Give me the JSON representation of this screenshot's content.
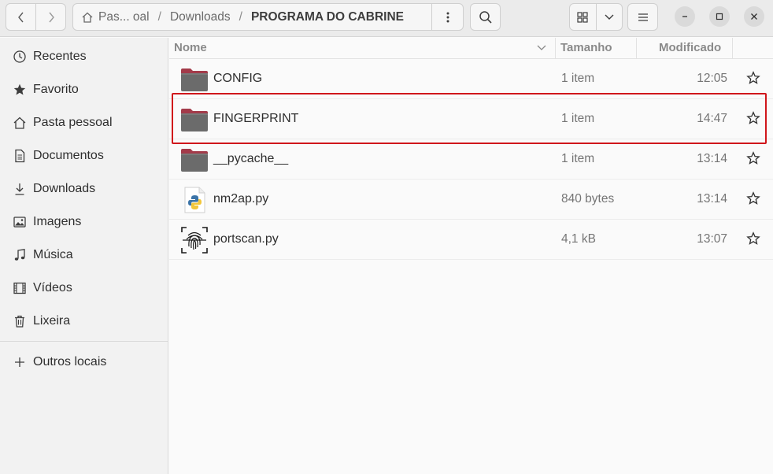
{
  "header": {
    "path": [
      "Pas... oal",
      "Downloads",
      "PROGRAMA DO CABRINE"
    ],
    "back_icon": "chevron-left-icon",
    "forward_icon": "chevron-right-icon",
    "home_icon": "home-icon"
  },
  "sidebar": {
    "items": [
      {
        "label": "Recentes",
        "icon": "clock-icon"
      },
      {
        "label": "Favorito",
        "icon": "star-icon"
      },
      {
        "label": "Pasta pessoal",
        "icon": "home-icon"
      },
      {
        "label": "Documentos",
        "icon": "document-icon"
      },
      {
        "label": "Downloads",
        "icon": "download-icon"
      },
      {
        "label": "Imagens",
        "icon": "image-icon"
      },
      {
        "label": "Música",
        "icon": "music-icon"
      },
      {
        "label": "Vídeos",
        "icon": "film-icon"
      },
      {
        "label": "Lixeira",
        "icon": "trash-icon"
      }
    ],
    "other": {
      "label": "Outros locais",
      "icon": "plus-icon"
    }
  },
  "columns": {
    "name": "Nome",
    "size": "Tamanho",
    "modified": "Modificado"
  },
  "files": [
    {
      "name": "CONFIG",
      "size": "1 item",
      "modified": "12:05",
      "type": "folder"
    },
    {
      "name": "FINGERPRINT",
      "size": "1 item",
      "modified": "14:47",
      "type": "folder"
    },
    {
      "name": "__pycache__",
      "size": "1 item",
      "modified": "13:14",
      "type": "folder"
    },
    {
      "name": "nm2ap.py",
      "size": "840 bytes",
      "modified": "13:14",
      "type": "python"
    },
    {
      "name": "portscan.py",
      "size": "4,1 kB",
      "modified": "13:07",
      "type": "fingerprint"
    }
  ],
  "colors": {
    "highlight": "#d0161b",
    "folder": "#6b6b6b",
    "folder_tab": "#a33b4a"
  }
}
